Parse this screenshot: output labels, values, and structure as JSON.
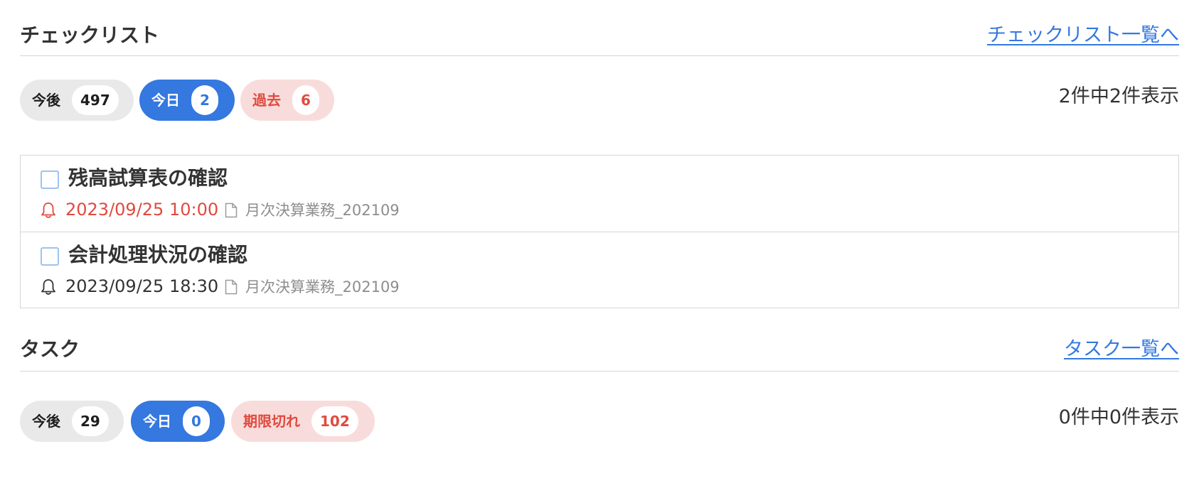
{
  "checklist": {
    "title": "チェックリスト",
    "link_label": "チェックリスト一覧へ",
    "filters": [
      {
        "label": "今後",
        "count": "497"
      },
      {
        "label": "今日",
        "count": "2"
      },
      {
        "label": "過去",
        "count": "6"
      }
    ],
    "count_text": "2件中2件表示",
    "items": [
      {
        "title": "残高試算表の確認",
        "datetime": "2023/09/25 10:00",
        "workflow": "月次決算業務_202109",
        "overdue": true
      },
      {
        "title": "会計処理状況の確認",
        "datetime": "2023/09/25 18:30",
        "workflow": "月次決算業務_202109",
        "overdue": false
      }
    ]
  },
  "tasks": {
    "title": "タスク",
    "link_label": "タスク一覧へ",
    "filters": [
      {
        "label": "今後",
        "count": "29"
      },
      {
        "label": "今日",
        "count": "0"
      },
      {
        "label": "期限切れ",
        "count": "102"
      }
    ],
    "count_text": "0件中0件表示"
  },
  "colors": {
    "accent": "#3478e0",
    "overdue": "#e04a3f",
    "overdue_bg": "#f8dcdb",
    "neutral_bg": "#e9e9e9",
    "muted_text": "#8d8d8d"
  },
  "icons": {
    "reminder": "bell-icon",
    "workflow": "document-icon"
  }
}
